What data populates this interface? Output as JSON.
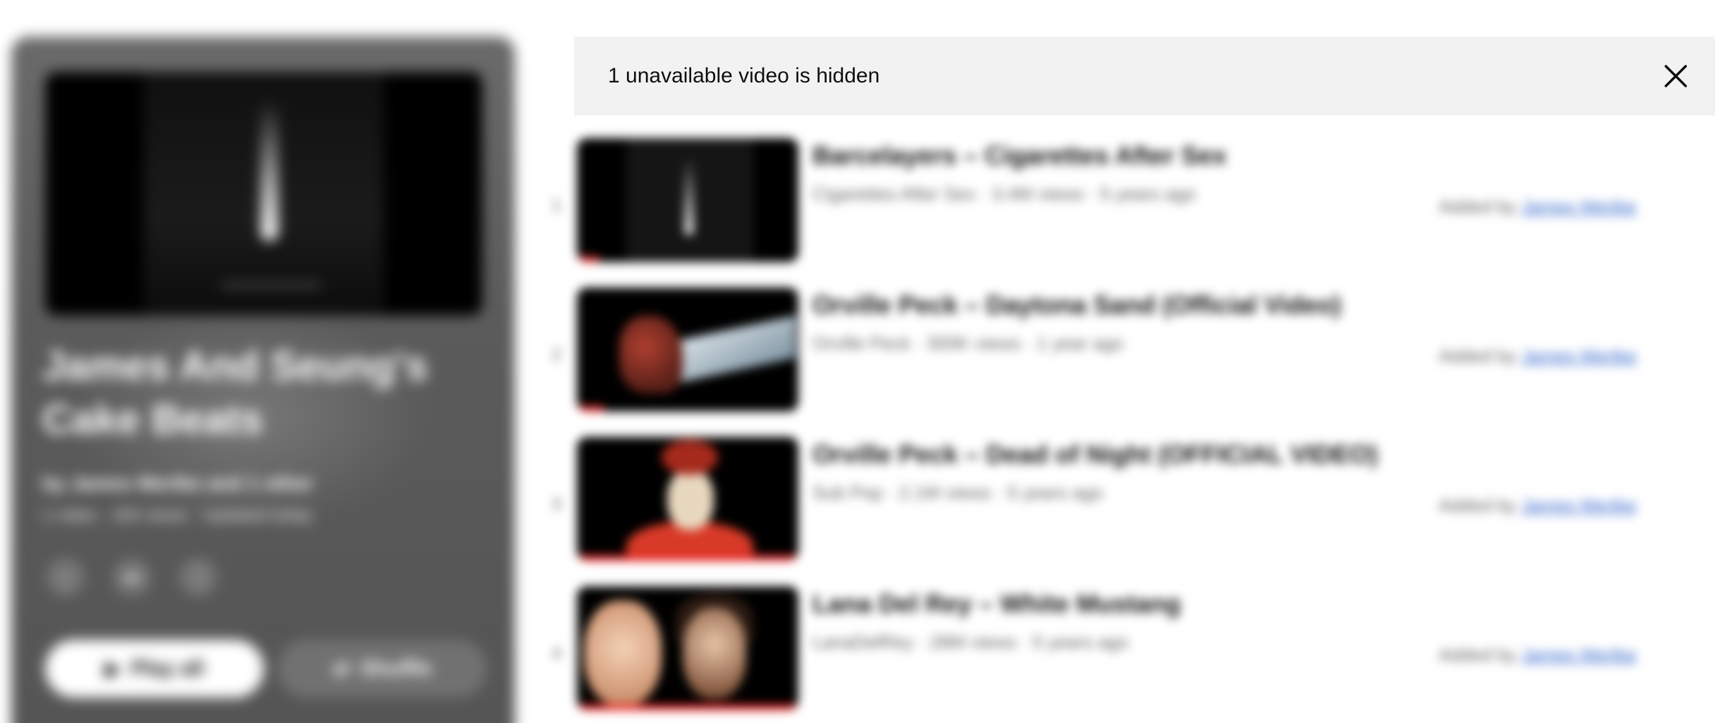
{
  "window": {
    "width": 2460,
    "height": 1026
  },
  "playlist_header": {
    "title": "James And Seung's Cake Beats",
    "owner": "by James Mertke and 1 other",
    "stats": "1 video · 200 views · Updated today",
    "play_all_label": "Play all",
    "shuffle_label": "Shuffle",
    "icons": [
      "download-icon",
      "share-icon",
      "more-icon"
    ]
  },
  "notice": {
    "text": "1 unavailable video is hidden",
    "close_icon": "close-icon"
  },
  "videos": [
    {
      "index": "1",
      "title": "Barcelayers – Cigarettes After Sex",
      "meta": "Cigarettes After Sex · 3.4M views · 5 years ago",
      "added_prefix": "Added by",
      "added_by": "James Mertke",
      "progress": 0.1
    },
    {
      "index": "2",
      "title": "Orville Peck – Daytona Sand (Official Video)",
      "meta": "Orville Peck · 300K views · 1 year ago",
      "added_prefix": "Added by",
      "added_by": "James Mertke",
      "progress": 0.12
    },
    {
      "index": "3",
      "title": "Orville Peck – Dead of Night (OFFICIAL VIDEO)",
      "meta": "Sub Pop · 2.1M views · 5 years ago",
      "added_prefix": "Added by",
      "added_by": "James Mertke",
      "progress": 1.0
    },
    {
      "index": "4",
      "title": "Lana Del Rey – White Mustang",
      "meta": "LanaDelRey · 28M views · 5 years ago",
      "added_prefix": "Added by",
      "added_by": "James Mertke",
      "progress": 1.0
    }
  ],
  "colors": {
    "panel_bg": "#5e5e5e",
    "notice_bg": "#f2f2f2",
    "progress_red": "#e82020",
    "link_blue": "#3366cc"
  }
}
